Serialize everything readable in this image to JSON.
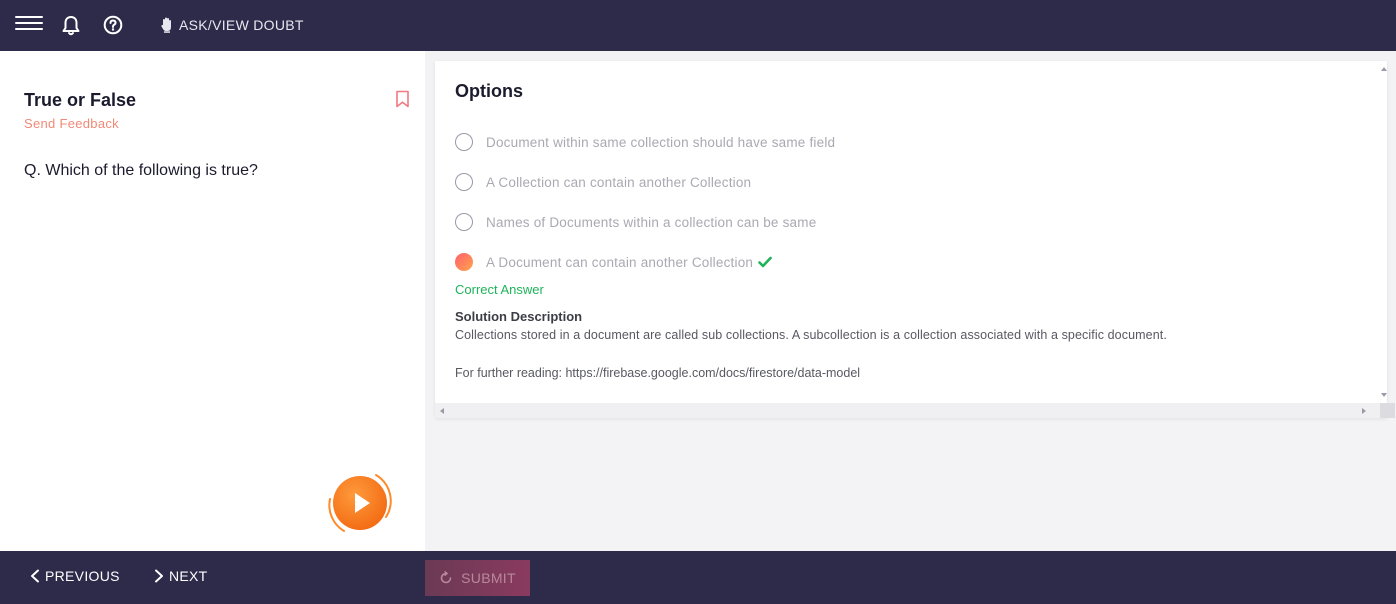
{
  "topbar": {
    "ask_doubt_label": "ASK/VIEW DOUBT",
    "icons": [
      "menu-icon",
      "bell-icon",
      "help-icon",
      "hand-icon"
    ]
  },
  "question": {
    "type_title": "True or False",
    "send_feedback": "Send Feedback",
    "text": "Q. Which of the following is true?"
  },
  "options": {
    "title": "Options",
    "items": [
      {
        "label": "Document within same collection should have same field",
        "selected": false
      },
      {
        "label": "A Collection can contain another Collection",
        "selected": false
      },
      {
        "label": "Names of Documents within a collection can be same",
        "selected": false
      },
      {
        "label": "A Document can contain another Collection",
        "selected": true,
        "correct": true
      }
    ],
    "correct_answer_label": "Correct Answer",
    "solution_title": "Solution Description",
    "solution_text": "Collections stored in a document are called sub collections. A subcollection is a collection associated with a specific document.",
    "further_reading": "For further reading: https://firebase.google.com/docs/firestore/data-model"
  },
  "bottombar": {
    "previous_label": "PREVIOUS",
    "next_label": "NEXT",
    "submit_label": "SUBMIT"
  },
  "colors": {
    "nav_bg": "#2d2a4a",
    "feedback": "#f08a77",
    "correct": "#1fb45a",
    "accent_orange": "#ff7a1a"
  }
}
